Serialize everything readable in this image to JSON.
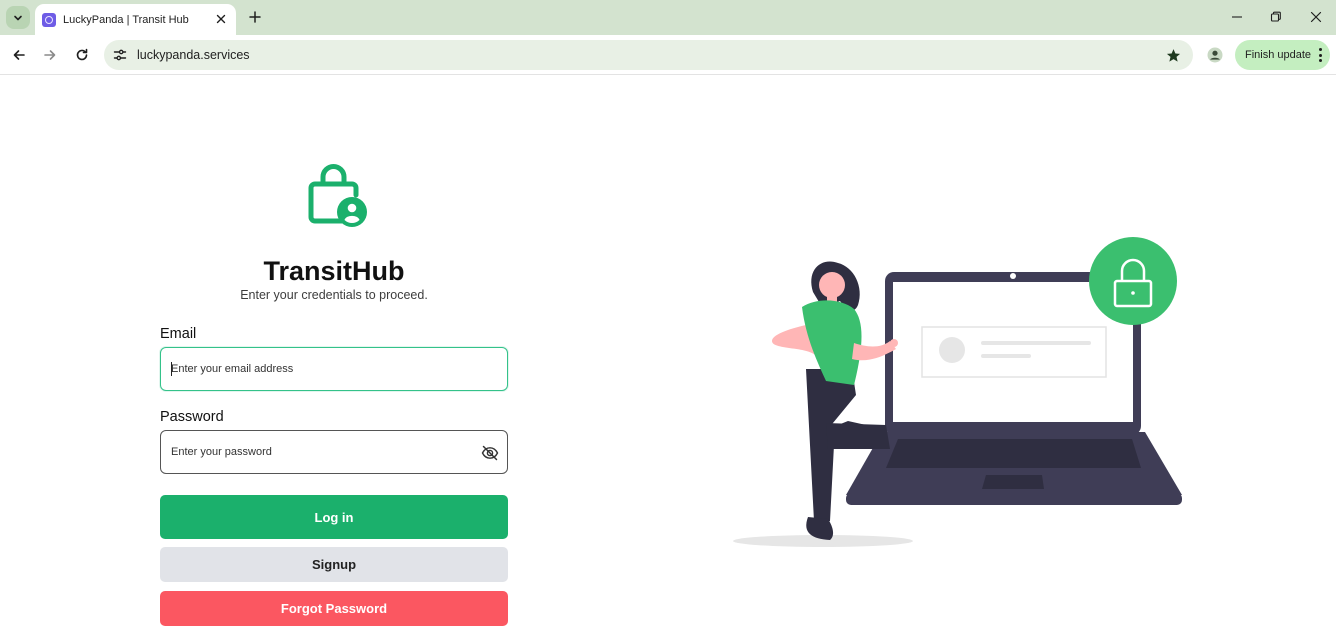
{
  "browser": {
    "tab": {
      "title": "LuckyPanda | Transit Hub"
    },
    "address_bar": {
      "url": "luckypanda.services"
    },
    "finish_update_label": "Finish update"
  },
  "login": {
    "title": "TransitHub",
    "subtitle": "Enter your credentials to proceed.",
    "email": {
      "label": "Email",
      "placeholder": "Enter your email address",
      "value": ""
    },
    "password": {
      "label": "Password",
      "placeholder": "Enter your password",
      "value": ""
    },
    "login_button": "Log in",
    "signup_button": "Signup",
    "forgot_button": "Forgot Password"
  },
  "colors": {
    "brand_green": "#1bb06c",
    "danger_red": "#fb5761",
    "chrome_green": "#d3e3cf"
  }
}
